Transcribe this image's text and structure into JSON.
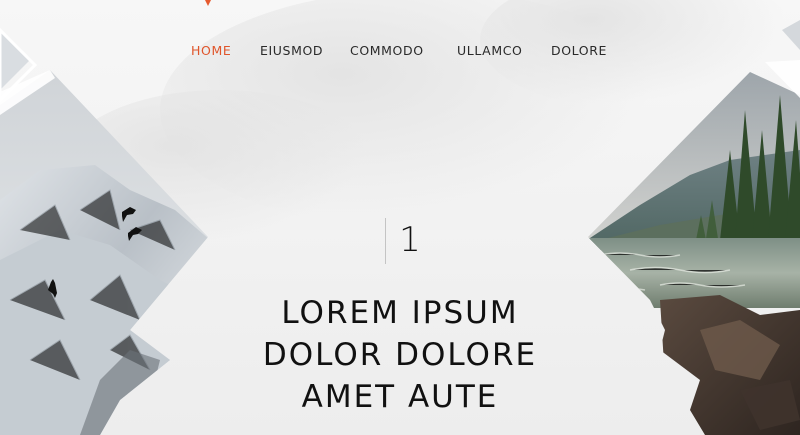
{
  "nav": {
    "items": [
      {
        "label": "HOME",
        "active": true
      },
      {
        "label": "EIUSMOD",
        "active": false
      },
      {
        "label": "COMMODO",
        "active": false
      },
      {
        "label": "ULLAMCO",
        "active": false
      },
      {
        "label": "DOLORE",
        "active": false
      }
    ]
  },
  "slider": {
    "current": "1"
  },
  "hero": {
    "lines": [
      "LOREM IPSUM",
      "DOLOR DOLORE",
      "AMET AUTE"
    ]
  },
  "colors": {
    "accent": "#e0552b",
    "text": "#111111",
    "background": "#f2f2f2"
  },
  "images": {
    "left": "snowy-mountain-with-birds",
    "right": "mountain-river-forest"
  }
}
